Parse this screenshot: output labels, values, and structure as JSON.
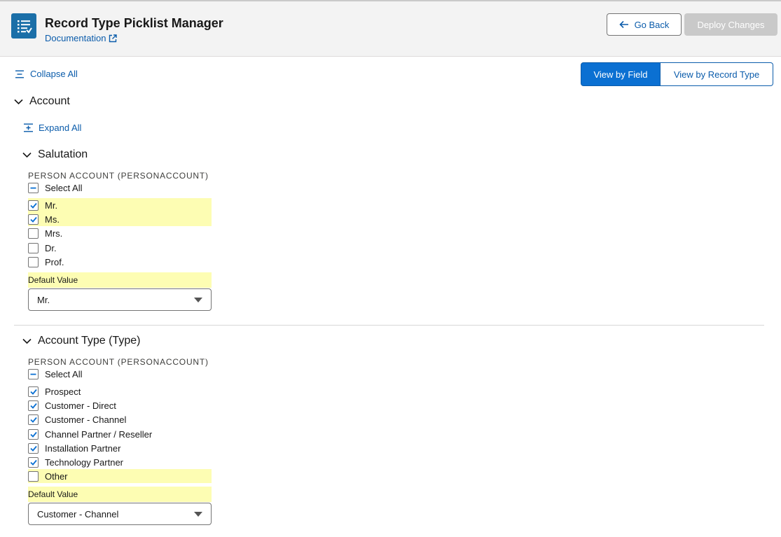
{
  "header": {
    "title": "Record Type Picklist Manager",
    "documentation_label": "Documentation",
    "go_back_label": "Go Back",
    "deploy_label": "Deploy Changes"
  },
  "toolbar": {
    "collapse_all_label": "Collapse All",
    "view_by_field_label": "View by Field",
    "view_by_record_type_label": "View by Record Type",
    "active_view": "View by Field"
  },
  "object": {
    "name": "Account",
    "expand_all_label": "Expand All",
    "fields": [
      {
        "name": "Salutation",
        "record_type": "PERSON ACCOUNT (PERSONACCOUNT)",
        "select_all_label": "Select All",
        "select_all_state": "indeterminate",
        "options": [
          {
            "label": "Mr.",
            "checked": true,
            "highlighted": true
          },
          {
            "label": "Ms.",
            "checked": true,
            "highlighted": true
          },
          {
            "label": "Mrs.",
            "checked": false,
            "highlighted": false
          },
          {
            "label": "Dr.",
            "checked": false,
            "highlighted": false
          },
          {
            "label": "Prof.",
            "checked": false,
            "highlighted": false
          }
        ],
        "default_label": "Default Value",
        "default_value": "Mr."
      },
      {
        "name": "Account Type (Type)",
        "record_type": "PERSON ACCOUNT (PERSONACCOUNT)",
        "select_all_label": "Select All",
        "select_all_state": "indeterminate",
        "options": [
          {
            "label": "Prospect",
            "checked": true,
            "highlighted": false
          },
          {
            "label": "Customer - Direct",
            "checked": true,
            "highlighted": false
          },
          {
            "label": "Customer - Channel",
            "checked": true,
            "highlighted": false
          },
          {
            "label": "Channel Partner / Reseller",
            "checked": true,
            "highlighted": false
          },
          {
            "label": "Installation Partner",
            "checked": true,
            "highlighted": false
          },
          {
            "label": "Technology Partner",
            "checked": true,
            "highlighted": false
          },
          {
            "label": "Other",
            "checked": false,
            "highlighted": true
          }
        ],
        "default_label": "Default Value",
        "default_value": "Customer - Channel"
      }
    ]
  },
  "colors": {
    "brand": "#0b70d2",
    "link": "#0b5cab",
    "highlight": "#fdfdb3",
    "disabled_button": "#c9c9c9",
    "app_icon": "#1b6fa8"
  },
  "icons": {
    "app": "list-icon",
    "external_link": "external-link-icon",
    "back": "arrow-left-icon",
    "collapse": "collapse-all-icon",
    "expand": "expand-all-icon",
    "chevron": "chevron-down-icon",
    "check": "check-icon",
    "minus": "minus-icon"
  }
}
